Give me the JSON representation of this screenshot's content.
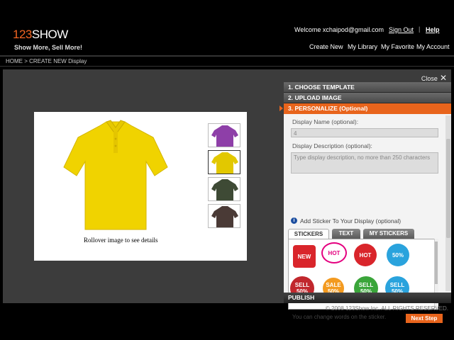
{
  "header": {
    "logo_num": "123",
    "logo_word": "SHOW",
    "tagline": "Show More, Sell More!",
    "welcome": "Welcome xchaipod@gmail.com",
    "sign_out": "Sign Out",
    "separator": "|",
    "help": "Help",
    "nav": [
      "Create New",
      "My Library",
      "My Favorite",
      "My Account"
    ]
  },
  "breadcrumb": "HOME > CREATE NEW Display",
  "stage": {
    "close_label": "Close",
    "close_glyph": "✕",
    "rollover_text": "Rollover image to see details",
    "thumb_colors": [
      "#8e3fa8",
      "#e2c800",
      "#3e4a35",
      "#4a3a36"
    ],
    "main_shirt_color": "#f0d300"
  },
  "panel": {
    "step1": "1.  CHOOSE TEMPLATE",
    "step2": "2.  UPLOAD IMAGE",
    "step3": "3.  PERSONALIZE (Optional)",
    "display_name_label": "Display Name (optional):",
    "display_name_value": "4",
    "display_desc_label": "Display Description (optional):",
    "display_desc_placeholder": "Type display description, no more than 250 characters",
    "info_glyph": "i",
    "sticker_heading": "Add Sticker To Your Display (optional)",
    "tabs": [
      "STICKERS",
      "TEXT",
      "MY STICKERS"
    ],
    "stickers": [
      {
        "text": "NEW",
        "color": "#d9252b"
      },
      {
        "text": "HOT",
        "color": "#e4007f"
      },
      {
        "text": "HOT",
        "color": "#d9252b"
      },
      {
        "text": "50%",
        "color": "#2aa3dd"
      },
      {
        "text": "SELL 50%",
        "color": "#c1272d"
      },
      {
        "text": "SALE 50%",
        "color": "#f39a1f"
      },
      {
        "text": "SELL 50%",
        "color": "#3aa53a"
      },
      {
        "text": "SELL 50%",
        "color": "#2aa3dd"
      }
    ],
    "tip": "You can change words on the sticker.",
    "next_label": "Next Step",
    "publish": "PUBLISH"
  },
  "footer": "© 2008 123Show Inc. ALL RIGHTS RESERVED."
}
